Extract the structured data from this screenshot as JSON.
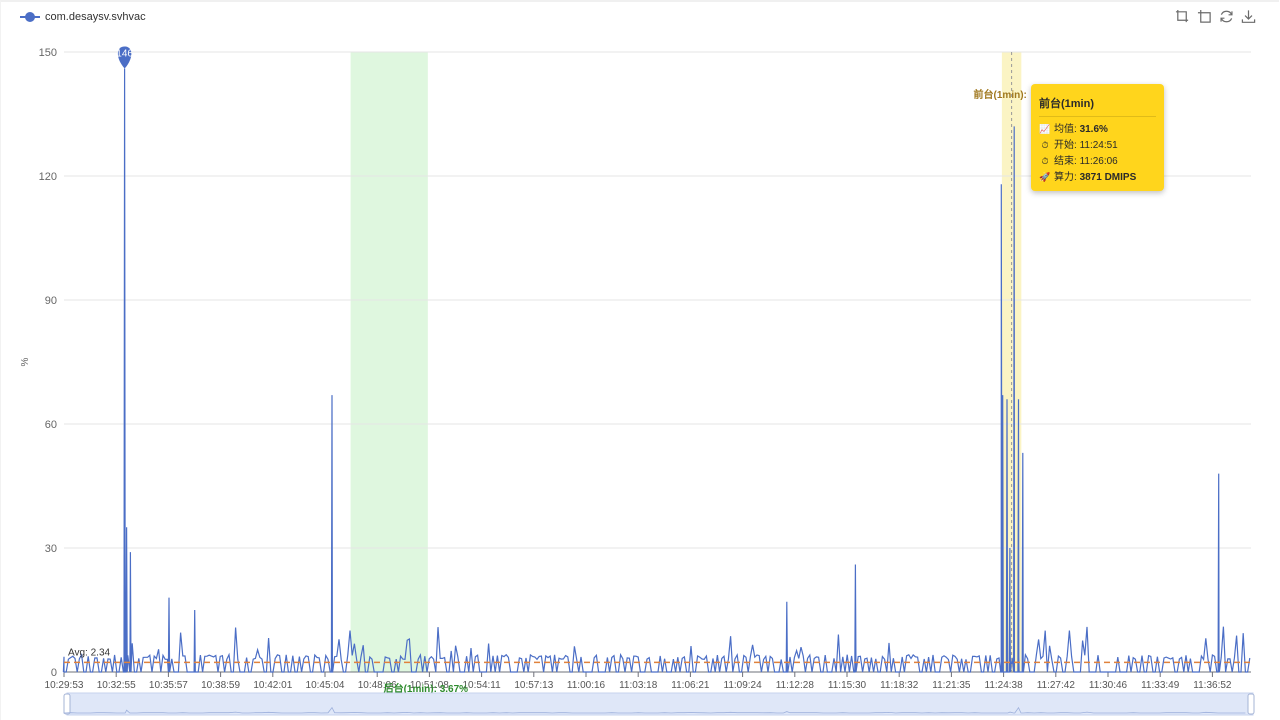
{
  "legend": {
    "series_name": "com.desaysv.svhvac",
    "color": "#4b6ec6"
  },
  "toolbox": [
    {
      "name": "zoom-icon"
    },
    {
      "name": "zoom-reset-icon"
    },
    {
      "name": "restore-icon"
    },
    {
      "name": "download-icon"
    }
  ],
  "chart_data": {
    "type": "line",
    "ylabel": "%",
    "ylim": [
      0,
      150
    ],
    "y_ticks": [
      "0",
      "30",
      "60",
      "90",
      "120",
      "150"
    ],
    "x_ticks": [
      "10:29:53",
      "10:32:55",
      "10:35:57",
      "10:38:59",
      "10:42:01",
      "10:45:04",
      "10:48:06",
      "10:51:08",
      "10:54:11",
      "10:57:13",
      "11:00:16",
      "11:03:18",
      "11:06:21",
      "11:09:24",
      "11:12:28",
      "11:15:30",
      "11:18:32",
      "11:21:35",
      "11:24:38",
      "11:27:42",
      "11:30:46",
      "11:33:49",
      "11:36:52"
    ],
    "max_label": "146",
    "avg_label": "Avg: 2.34",
    "avg_value": 2.34,
    "series": [
      {
        "name": "com.desaysv.svhvac",
        "color": "#4b6ec6",
        "x": [
          "10:29:53",
          "10:33:25",
          "10:33:32",
          "10:33:45",
          "10:36:00",
          "10:37:30",
          "10:45:30",
          "11:12:00",
          "11:16:00",
          "11:24:30",
          "11:24:35",
          "11:24:50",
          "11:25:00",
          "11:25:15",
          "11:25:30",
          "11:25:45",
          "11:37:10"
        ],
        "values": [
          0,
          146,
          35,
          29,
          18,
          15,
          67,
          17,
          26,
          118,
          67,
          66,
          30,
          132,
          66,
          53,
          48
        ]
      }
    ],
    "baseline_level": 3,
    "highlight_bands": [
      {
        "label": "后台(1min): 3.67%",
        "start": "10:46:35",
        "end": "10:51:05",
        "color": "#dff7df",
        "text_color": "#2e8b2e"
      },
      {
        "label": "前台(1min):",
        "start": "11:24:32",
        "end": "11:25:40",
        "color": "#fbf4c4",
        "text_color": "#a0781e"
      }
    ]
  },
  "tooltip": {
    "title": "前台(1min)",
    "avg_label": "均值:",
    "avg_value": "31.6%",
    "start_label": "开始:",
    "start_value": "11:24:51",
    "end_label": "结束:",
    "end_value": "11:26:06",
    "power_label": "算力:",
    "power_value": "3871 DMIPS"
  },
  "datazoom": {
    "fill": "#dfe7f8",
    "border": "#c7d3ee"
  }
}
